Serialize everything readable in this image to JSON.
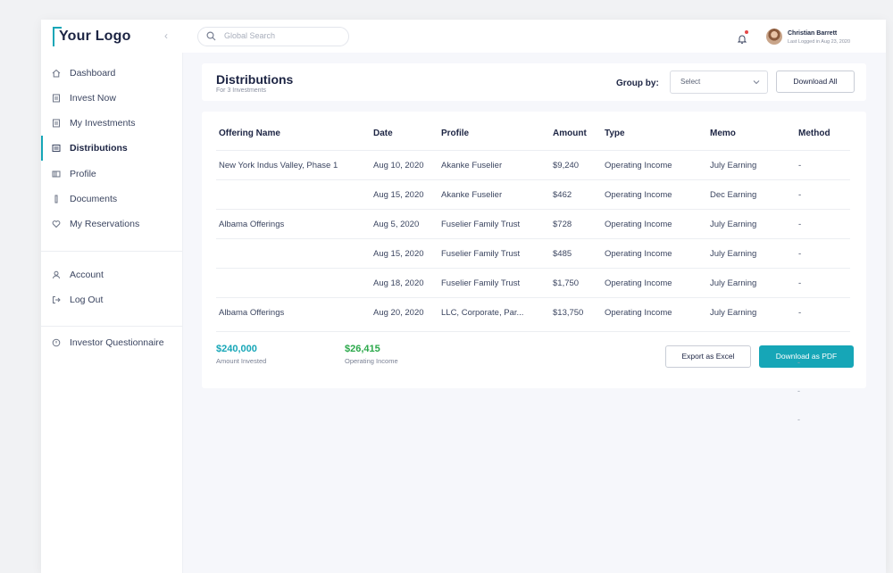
{
  "header": {
    "logo": "Your Logo",
    "collapse_glyph": "‹",
    "search_placeholder": "Global Search",
    "user_name": "Christian Barrett",
    "user_last_login": "Last Logged in Aug 23, 2020"
  },
  "sidebar": {
    "items": [
      {
        "label": "Dashboard",
        "icon": "home-icon"
      },
      {
        "label": "Invest Now",
        "icon": "document-icon"
      },
      {
        "label": "My Investments",
        "icon": "document-icon"
      },
      {
        "label": "Distributions",
        "icon": "list-icon",
        "active": true
      },
      {
        "label": "Profile",
        "icon": "id-card-icon"
      },
      {
        "label": "Documents",
        "icon": "file-icon"
      },
      {
        "label": "My Reservations",
        "icon": "heart-icon"
      }
    ],
    "account_items": [
      {
        "label": "Account",
        "icon": "user-icon"
      },
      {
        "label": "Log Out",
        "icon": "logout-icon"
      }
    ],
    "extra_items": [
      {
        "label": "Investor Questionnaire",
        "icon": "question-icon"
      }
    ]
  },
  "page": {
    "title": "Distributions",
    "subtitle": "For 3 Investments",
    "group_by_label": "Group by:",
    "group_by_value": "Select",
    "download_all_label": "Download All"
  },
  "table": {
    "columns": [
      "Offering Name",
      "Date",
      "Profile",
      "Amount",
      "Type",
      "Memo",
      "Method"
    ],
    "rows": [
      [
        "New York Indus Valley, Phase 1",
        "Aug 10, 2020",
        "Akanke Fuselier",
        "$9,240",
        "Operating Income",
        "July Earning",
        "-"
      ],
      [
        "",
        "Aug 15, 2020",
        "Akanke Fuselier",
        "$462",
        "Operating Income",
        "Dec Earning",
        "-"
      ],
      [
        "Albama Offerings",
        "Aug 5, 2020",
        "Fuselier Family Trust",
        "$728",
        "Operating Income",
        "July Earning",
        "-"
      ],
      [
        "",
        "Aug 15, 2020",
        "Fuselier Family Trust",
        "$485",
        "Operating Income",
        "July Earning",
        "-"
      ],
      [
        "",
        "Aug 18, 2020",
        "Fuselier Family Trust",
        "$1,750",
        "Operating Income",
        "July Earning",
        "-"
      ],
      [
        "Albama Offerings",
        "Aug 20, 2020",
        "LLC, Corporate, Par...",
        "$13,750",
        "Operating Income",
        "July Earning",
        "-"
      ]
    ]
  },
  "summary": {
    "invested_amount": "$240,000",
    "invested_label": "Amount Invested",
    "income_amount": "$26,415",
    "income_label": "Operating Income",
    "export_label": "Export as Excel",
    "pdf_label": "Download as PDF",
    "stray_dashes": [
      "-",
      "-",
      "-"
    ]
  },
  "colors": {
    "accent": "#16a6b7",
    "invested": "#16a6b7",
    "income": "#2aa84a",
    "notification_dot": "#e54848"
  }
}
